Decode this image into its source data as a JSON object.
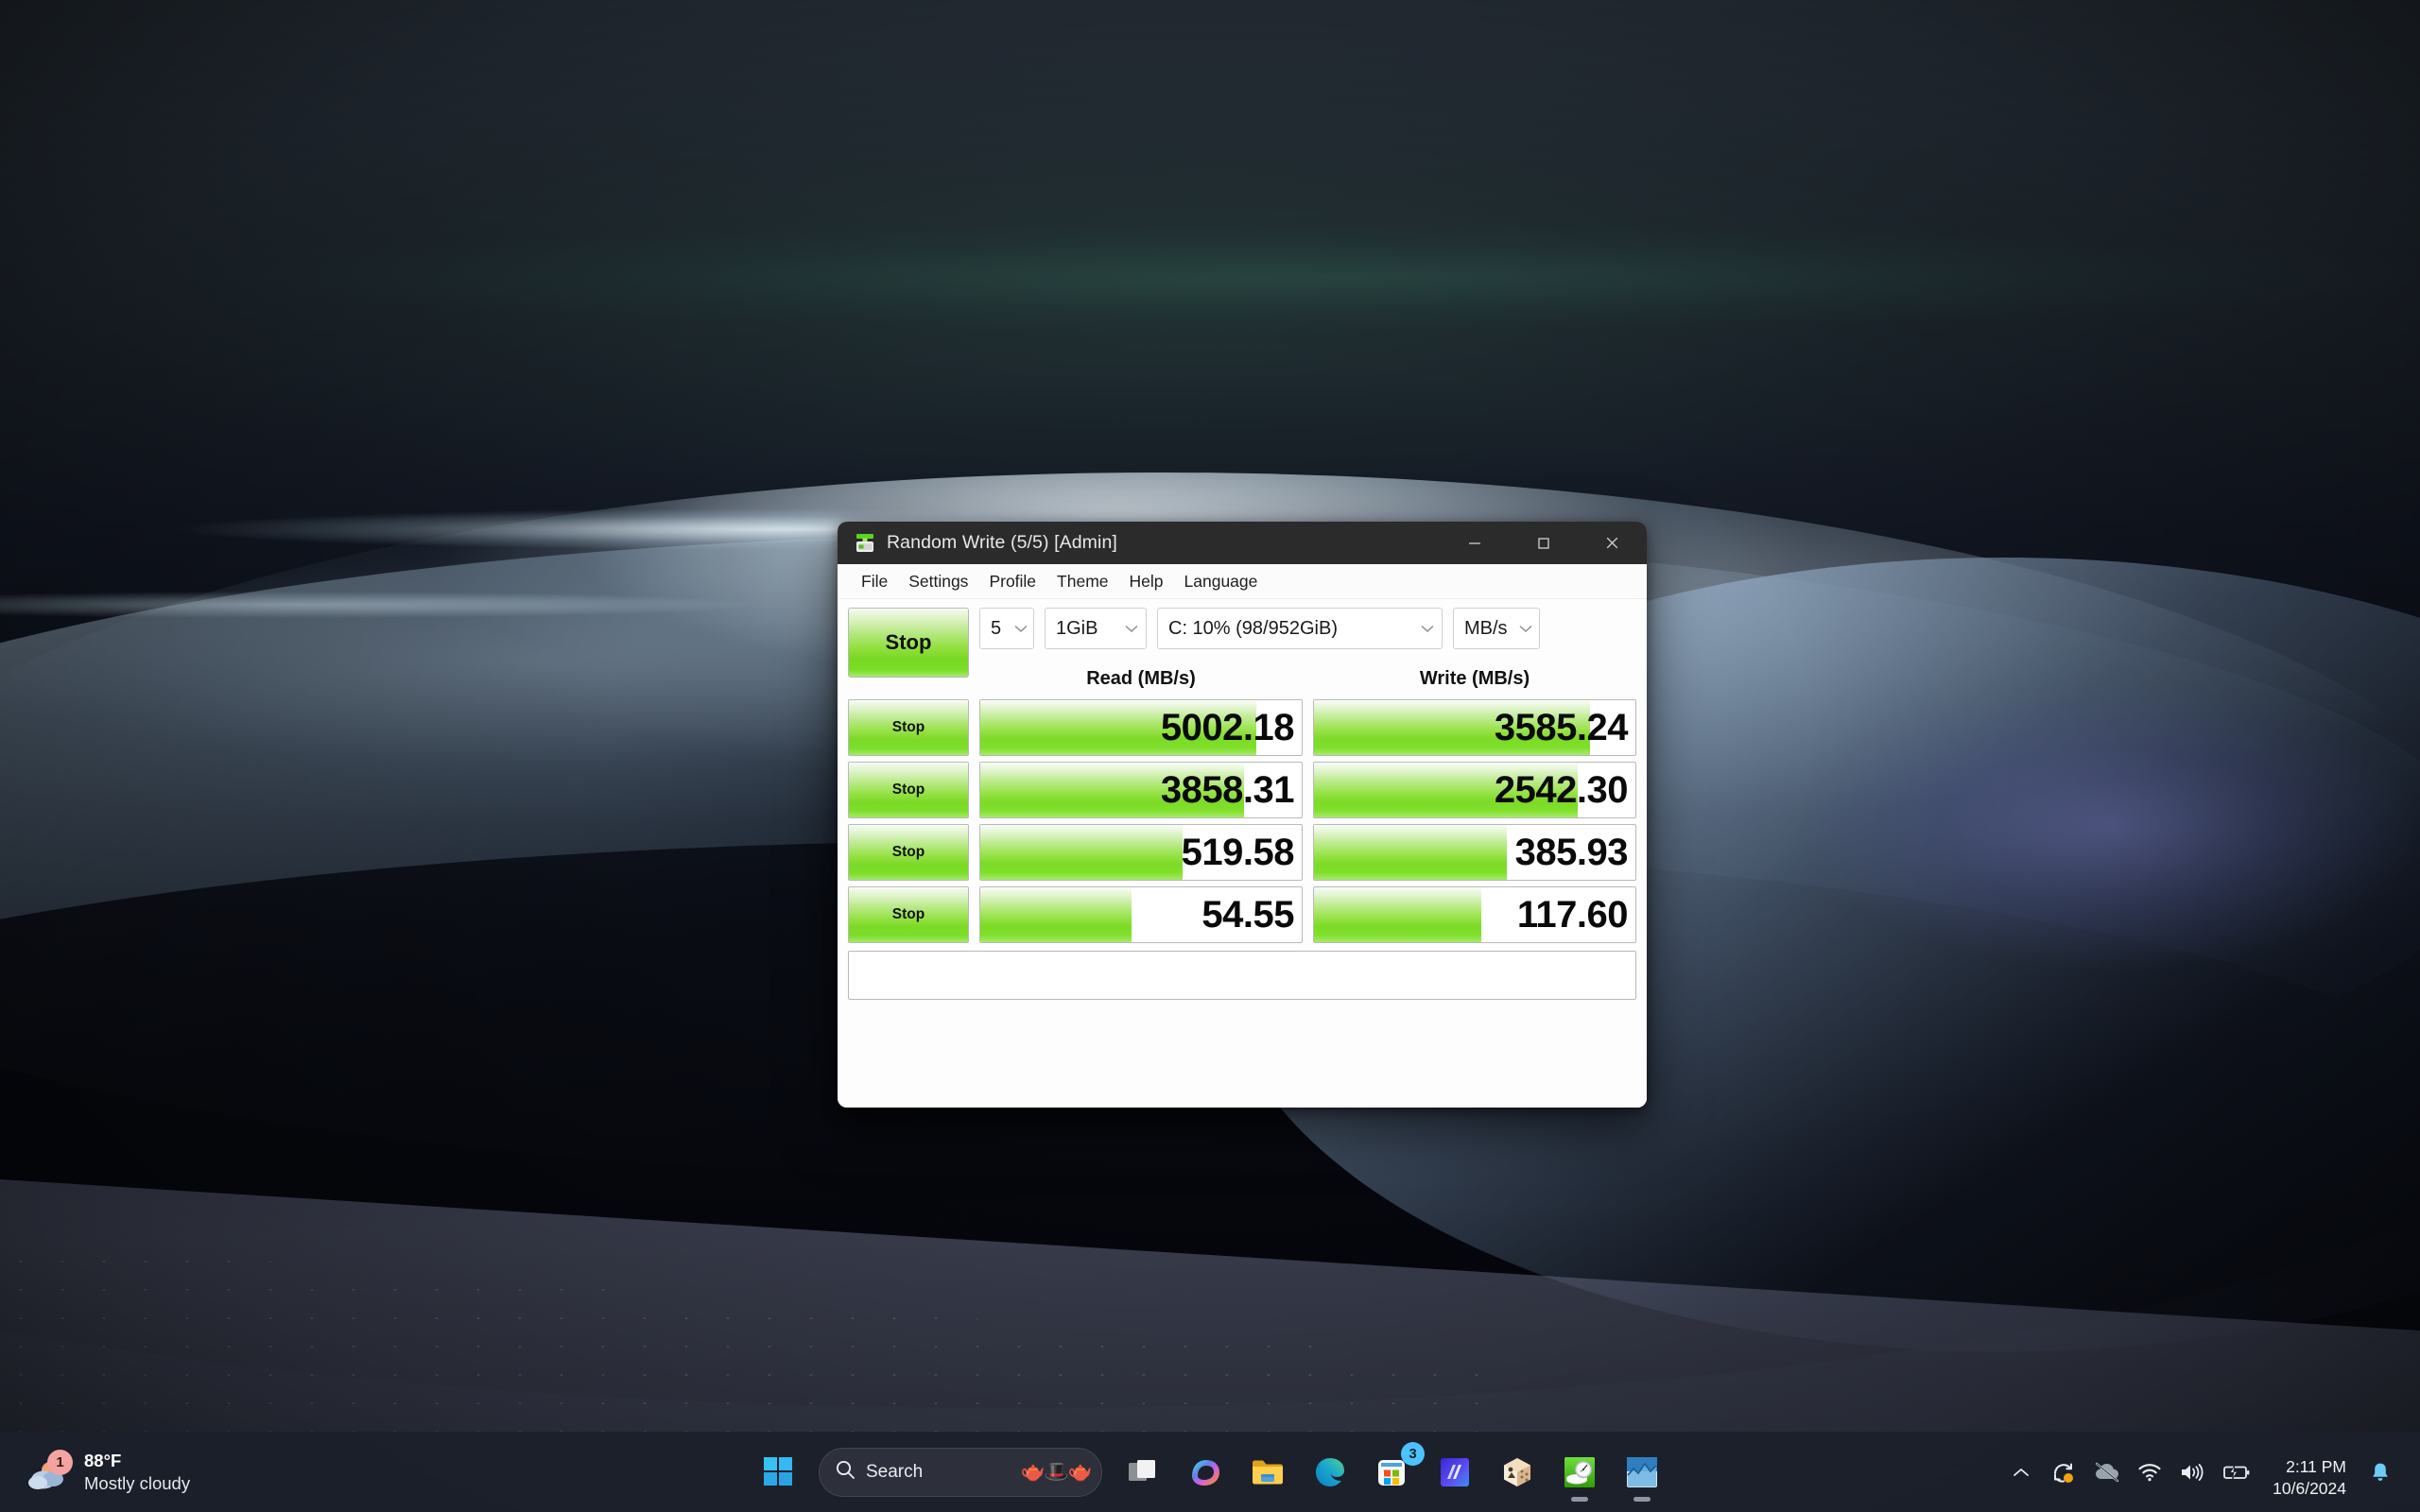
{
  "window": {
    "title": "Random Write (5/5) [Admin]",
    "icon": "disk-drive-icon",
    "controls": {
      "minimize": "minimize-icon",
      "maximize": "maximize-icon",
      "close": "close-icon"
    },
    "menu": [
      "File",
      "Settings",
      "Profile",
      "Theme",
      "Help",
      "Language"
    ],
    "toolbar": {
      "run_button_label": "Stop",
      "test_count": "5",
      "test_size": "1GiB",
      "target_drive": "C: 10% (98/952GiB)",
      "unit": "MB/s"
    },
    "columns": {
      "row_label": "",
      "read": "Read (MB/s)",
      "write": "Write (MB/s)"
    },
    "rows": [
      {
        "button": "Stop",
        "read": "5002.18",
        "write": "3585.24",
        "read_pct": 86,
        "write_pct": 86
      },
      {
        "button": "Stop",
        "read": "3858.31",
        "write": "2542.30",
        "read_pct": 82,
        "write_pct": 82
      },
      {
        "button": "Stop",
        "read": "519.58",
        "write": "385.93",
        "read_pct": 63,
        "write_pct": 60
      },
      {
        "button": "Stop",
        "read": "54.55",
        "write": "117.60",
        "read_pct": 47,
        "write_pct": 52
      }
    ],
    "status_text": ""
  },
  "taskbar": {
    "weather": {
      "badge": "1",
      "temperature": "88°F",
      "condition": "Mostly cloudy",
      "icon": "cloud-icon"
    },
    "start": {
      "name": "start-button",
      "icon": "windows-logo-icon"
    },
    "search": {
      "placeholder": "Search",
      "icon": "search-icon",
      "decoration": "tea-party-illustration"
    },
    "apps": [
      {
        "name": "task-view",
        "icon": "task-view-icon",
        "active": false,
        "badge": ""
      },
      {
        "name": "copilot",
        "icon": "copilot-icon",
        "active": false,
        "badge": ""
      },
      {
        "name": "file-explorer",
        "icon": "folder-icon",
        "active": false,
        "badge": ""
      },
      {
        "name": "microsoft-edge",
        "icon": "edge-icon",
        "active": false,
        "badge": ""
      },
      {
        "name": "microsoft-store",
        "icon": "store-icon",
        "active": false,
        "badge": "3"
      },
      {
        "name": "clipchamp",
        "icon": "clipchamp-icon",
        "active": false,
        "badge": ""
      },
      {
        "name": "package-app",
        "icon": "box-icon",
        "active": false,
        "badge": ""
      },
      {
        "name": "crystaldiskmark",
        "icon": "crystaldiskmark-icon",
        "active": true,
        "badge": ""
      },
      {
        "name": "performance-app",
        "icon": "chart-icon",
        "active": true,
        "badge": ""
      }
    ],
    "tray": {
      "overflow": "chevron-up-icon",
      "sync": "sync-icon",
      "onedrive": "onedrive-offline-icon",
      "network": "wifi-icon",
      "volume": "speaker-icon",
      "battery": "battery-charging-icon",
      "time": "2:11 PM",
      "date": "10/6/2024",
      "notifications": "bell-icon"
    }
  },
  "colors": {
    "accent_green": "#7dda26",
    "titlebar": "#2b2b2b",
    "taskbar": "#1b202a",
    "badge_pink": "#f4a3a3",
    "store_badge_blue": "#4cc2ff"
  }
}
